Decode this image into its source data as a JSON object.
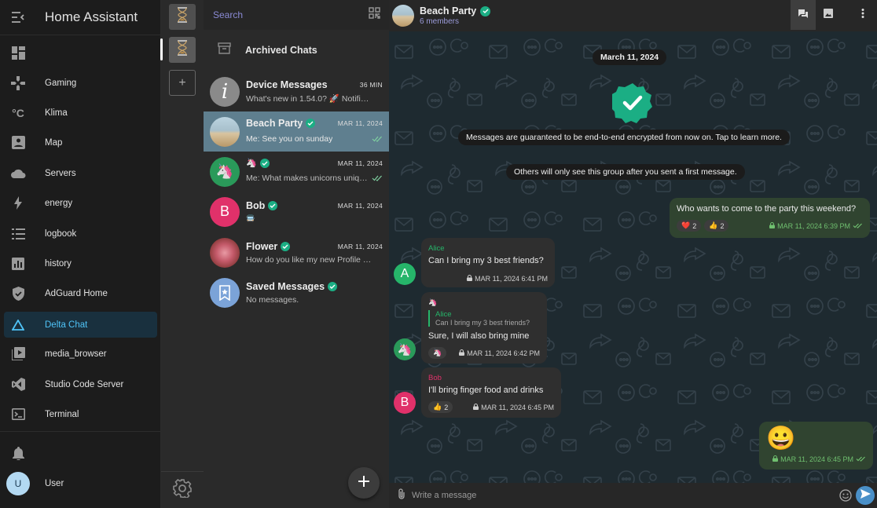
{
  "ha": {
    "title": "Home Assistant",
    "items": [
      {
        "name": "overview",
        "label": "",
        "icon": "dashboard-icon"
      },
      {
        "name": "gaming",
        "label": "Gaming",
        "icon": "gamepad-icon"
      },
      {
        "name": "klima",
        "label": "Klima",
        "icon": "temperature-icon"
      },
      {
        "name": "map",
        "label": "Map",
        "icon": "map-icon"
      },
      {
        "name": "servers",
        "label": "Servers",
        "icon": "cloud-icon"
      },
      {
        "name": "energy",
        "label": "energy",
        "icon": "lightning-icon"
      },
      {
        "name": "logbook",
        "label": "logbook",
        "icon": "list-icon"
      },
      {
        "name": "history",
        "label": "history",
        "icon": "chart-icon"
      },
      {
        "name": "adguard",
        "label": "AdGuard Home",
        "icon": "shield-icon"
      },
      {
        "name": "delta-chat",
        "label": "Delta Chat",
        "icon": "delta-icon",
        "active": true
      },
      {
        "name": "media-browser",
        "label": "media_browser",
        "icon": "play-box-icon"
      },
      {
        "name": "studio-code",
        "label": "Studio Code Server",
        "icon": "vscode-icon"
      },
      {
        "name": "terminal",
        "label": "Terminal",
        "icon": "terminal-icon"
      }
    ],
    "user": {
      "initial": "U",
      "name": "User"
    },
    "accent": "#4fc3f7"
  },
  "accounts": {
    "add_label": "+"
  },
  "list": {
    "search_placeholder": "Search",
    "archived_label": "Archived Chats",
    "chats": [
      {
        "name": "Device Messages",
        "date": "36 MIN",
        "preview": "What's new in 1.54.0? 🚀 Notifica…",
        "avatar": "info",
        "verified": false
      },
      {
        "name": "Beach Party",
        "date": "MAR 11, 2024",
        "preview": "Me: See you on sunday",
        "avatar": "beach",
        "verified": true,
        "selected": true,
        "read": true
      },
      {
        "name": "🦄",
        "date": "MAR 11, 2024",
        "preview": "Me: What makes unicorns unique?",
        "avatar": "unicorn",
        "verified": true,
        "read": true
      },
      {
        "name": "Bob",
        "date": "MAR 11, 2024",
        "preview": "🚍",
        "avatar": "B",
        "verified": true
      },
      {
        "name": "Flower",
        "date": "MAR 11, 2024",
        "preview": "How do you like my new Profile …",
        "avatar": "flower",
        "verified": true
      },
      {
        "name": "Saved Messages",
        "date": "",
        "preview": "No messages.",
        "avatar": "saved",
        "verified": true
      }
    ]
  },
  "chat": {
    "title": "Beach Party",
    "subtitle": "6 members",
    "date_pill": "March 11, 2024",
    "system1": "Messages are guaranteed to be end-to-end encrypted from now on. Tap to learn more.",
    "system2": "Others will only see this group after you sent a first message.",
    "messages": [
      {
        "dir": "out",
        "text": "Who wants to come to the party this weekend?",
        "time": "MAR 11, 2024 6:39 PM",
        "reactions": [
          {
            "emoji": "❤️",
            "count": "2"
          },
          {
            "emoji": "👍",
            "count": "2"
          }
        ]
      },
      {
        "dir": "in",
        "sender": "Alice",
        "text": "Can I bring my 3 best friends?",
        "time": "MAR 11, 2024 6:41 PM"
      },
      {
        "dir": "in",
        "sender": "🦄",
        "quote_sender": "Alice",
        "quote": "Can I bring my 3 best friends?",
        "text": "Sure, I will also bring mine",
        "time": "MAR 11, 2024 6:42 PM",
        "reaction": "🦄"
      },
      {
        "dir": "in",
        "sender": "Bob",
        "text": "I'll bring finger food and drinks",
        "time": "MAR 11, 2024 6:45 PM",
        "reactions": [
          {
            "emoji": "👍",
            "count": "2"
          }
        ]
      },
      {
        "dir": "out",
        "text": "😀",
        "time": "MAR 11, 2024 6:45 PM"
      }
    ],
    "composer_placeholder": "Write a message"
  },
  "colors": {
    "verified": "#1bae84",
    "alice": "#26b56a",
    "bob": "#e0316a",
    "unicorn_bg": "#2a9a5a"
  }
}
